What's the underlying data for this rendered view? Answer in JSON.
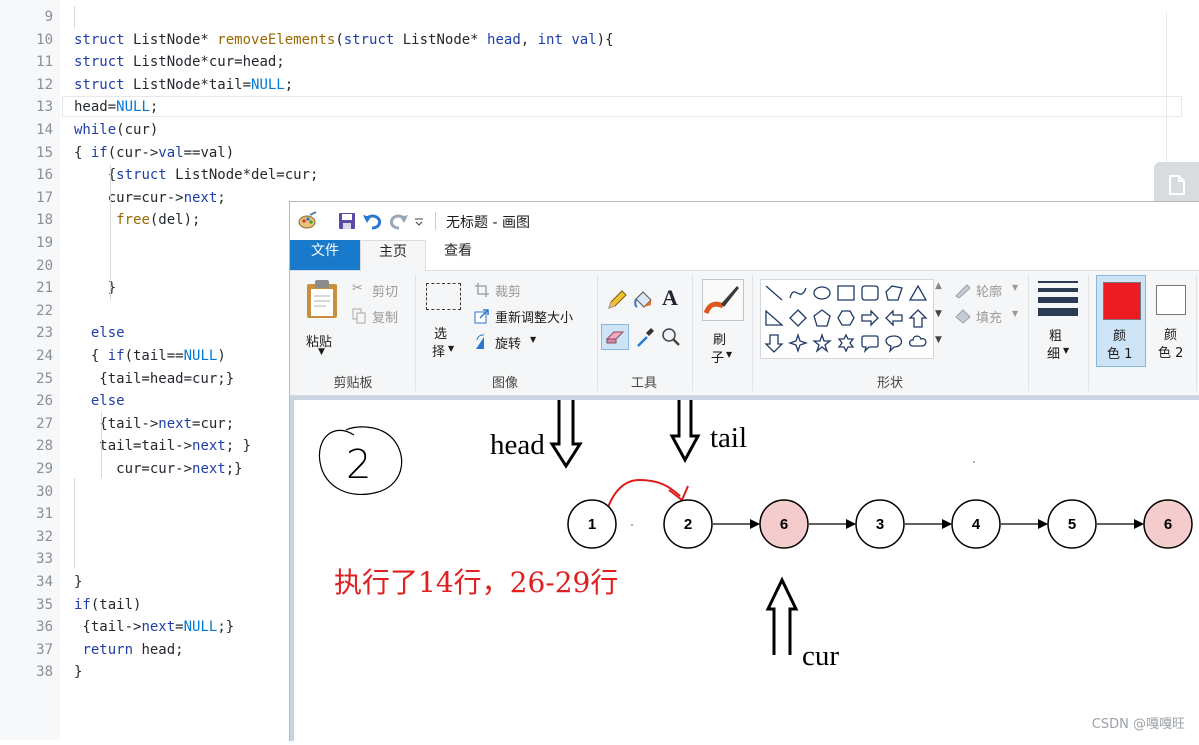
{
  "editor": {
    "lines": [
      {
        "n": "9",
        "tokens": []
      },
      {
        "n": "10",
        "tokens": [
          [
            "kw",
            "struct"
          ],
          [
            "id",
            " ListNode* "
          ],
          [
            "fn",
            "removeElements"
          ],
          [
            "pn",
            "("
          ],
          [
            "kw",
            "struct"
          ],
          [
            "id",
            " ListNode* "
          ],
          [
            "pr",
            "head"
          ],
          [
            "pn",
            ", "
          ],
          [
            "kw",
            "int"
          ],
          [
            "id",
            " "
          ],
          [
            "pr",
            "val"
          ],
          [
            "pn",
            "){"
          ]
        ]
      },
      {
        "n": "11",
        "tokens": [
          [
            "kw",
            "struct"
          ],
          [
            "id",
            " ListNode*cur=head;"
          ]
        ]
      },
      {
        "n": "12",
        "tokens": [
          [
            "kw",
            "struct"
          ],
          [
            "id",
            " ListNode*tail="
          ],
          [
            "nl",
            "NULL"
          ],
          [
            "pn",
            ";"
          ]
        ]
      },
      {
        "n": "13",
        "tokens": [
          [
            "id",
            "head="
          ],
          [
            "nl",
            "NULL"
          ],
          [
            "pn",
            ";"
          ]
        ]
      },
      {
        "n": "14",
        "tokens": [
          [
            "kw",
            "while"
          ],
          [
            "pn",
            "(cur)"
          ]
        ]
      },
      {
        "n": "15",
        "tokens": [
          [
            "pn",
            "{ "
          ],
          [
            "kw",
            "if"
          ],
          [
            "pn",
            "(cur->"
          ],
          [
            "pr",
            "val"
          ],
          [
            "pn",
            "==val)"
          ]
        ]
      },
      {
        "n": "16",
        "tokens": [
          [
            "id",
            "    {"
          ],
          [
            "kw",
            "struct"
          ],
          [
            "id",
            " ListNode*del=cur;"
          ]
        ]
      },
      {
        "n": "17",
        "tokens": [
          [
            "id",
            "    cur=cur->"
          ],
          [
            "pr",
            "next"
          ],
          [
            "pn",
            ";"
          ]
        ]
      },
      {
        "n": "18",
        "tokens": [
          [
            "id",
            "     "
          ],
          [
            "fn",
            "free"
          ],
          [
            "pn",
            "(del);"
          ]
        ]
      },
      {
        "n": "19",
        "tokens": []
      },
      {
        "n": "20",
        "tokens": []
      },
      {
        "n": "21",
        "tokens": [
          [
            "id",
            "    }"
          ]
        ]
      },
      {
        "n": "22",
        "tokens": []
      },
      {
        "n": "23",
        "tokens": [
          [
            "id",
            "  "
          ],
          [
            "kw",
            "else"
          ]
        ]
      },
      {
        "n": "24",
        "tokens": [
          [
            "id",
            "  { "
          ],
          [
            "kw",
            "if"
          ],
          [
            "pn",
            "(tail=="
          ],
          [
            "nl",
            "NULL"
          ],
          [
            "pn",
            ")"
          ]
        ]
      },
      {
        "n": "25",
        "tokens": [
          [
            "id",
            "   {tail=head=cur;}"
          ]
        ]
      },
      {
        "n": "26",
        "tokens": [
          [
            "id",
            "  "
          ],
          [
            "kw",
            "else"
          ]
        ]
      },
      {
        "n": "27",
        "tokens": [
          [
            "id",
            "   {tail->"
          ],
          [
            "pr",
            "next"
          ],
          [
            "pn",
            "=cur;"
          ]
        ]
      },
      {
        "n": "28",
        "tokens": [
          [
            "id",
            "   tail=tail->"
          ],
          [
            "pr",
            "next"
          ],
          [
            "pn",
            "; }"
          ]
        ]
      },
      {
        "n": "29",
        "tokens": [
          [
            "id",
            "     cur=cur->"
          ],
          [
            "pr",
            "next"
          ],
          [
            "pn",
            ";}"
          ]
        ]
      },
      {
        "n": "30",
        "tokens": []
      },
      {
        "n": "31",
        "tokens": []
      },
      {
        "n": "32",
        "tokens": []
      },
      {
        "n": "33",
        "tokens": []
      },
      {
        "n": "34",
        "tokens": [
          [
            "pn",
            "}"
          ]
        ]
      },
      {
        "n": "35",
        "tokens": [
          [
            "kw",
            "if"
          ],
          [
            "pn",
            "(tail)"
          ]
        ]
      },
      {
        "n": "36",
        "tokens": [
          [
            "id",
            " {tail->"
          ],
          [
            "pr",
            "next"
          ],
          [
            "pn",
            "="
          ],
          [
            "nl",
            "NULL"
          ],
          [
            "pn",
            ";}"
          ]
        ]
      },
      {
        "n": "37",
        "tokens": [
          [
            "id",
            " "
          ],
          [
            "kw",
            "return"
          ],
          [
            "id",
            " head;"
          ]
        ]
      },
      {
        "n": "38",
        "tokens": [
          [
            "pn",
            "}"
          ]
        ]
      }
    ]
  },
  "paint": {
    "title": "无标题 - 画图",
    "tabs": {
      "file": "文件",
      "home": "主页",
      "view": "查看"
    },
    "clipboard": {
      "paste": "粘贴",
      "cut": "剪切",
      "copy": "复制",
      "label": "剪贴板"
    },
    "image": {
      "select_1": "选",
      "select_2": "择",
      "crop": "裁剪",
      "resize": "重新调整大小",
      "rotate": "旋转",
      "label": "图像"
    },
    "tools": {
      "label": "工具"
    },
    "brush": {
      "line1": "刷",
      "line2": "子"
    },
    "shapes": {
      "outline": "轮廓",
      "fill": "填充",
      "label": "形状"
    },
    "size": {
      "line1": "粗",
      "line2": "细"
    },
    "color1": {
      "line1": "颜",
      "line2": "色 1",
      "value": "#ed1c24"
    },
    "color2": {
      "line1": "颜",
      "line2": "色 2",
      "value": "#ffffff"
    }
  },
  "drawing": {
    "circled_number": "2",
    "head_label": "head",
    "tail_label": "tail",
    "cur_label": "cur",
    "note": "执行了14行，26-29行",
    "nodes": [
      {
        "value": "1",
        "highlight": false
      },
      {
        "value": "2",
        "highlight": false
      },
      {
        "value": "6",
        "highlight": true
      },
      {
        "value": "3",
        "highlight": false
      },
      {
        "value": "4",
        "highlight": false
      },
      {
        "value": "5",
        "highlight": false
      },
      {
        "value": "6",
        "highlight": true
      }
    ],
    "highlight_color": "#f4cccc",
    "note_color": "#e02020"
  },
  "watermark": "CSDN @嘎嘎旺"
}
